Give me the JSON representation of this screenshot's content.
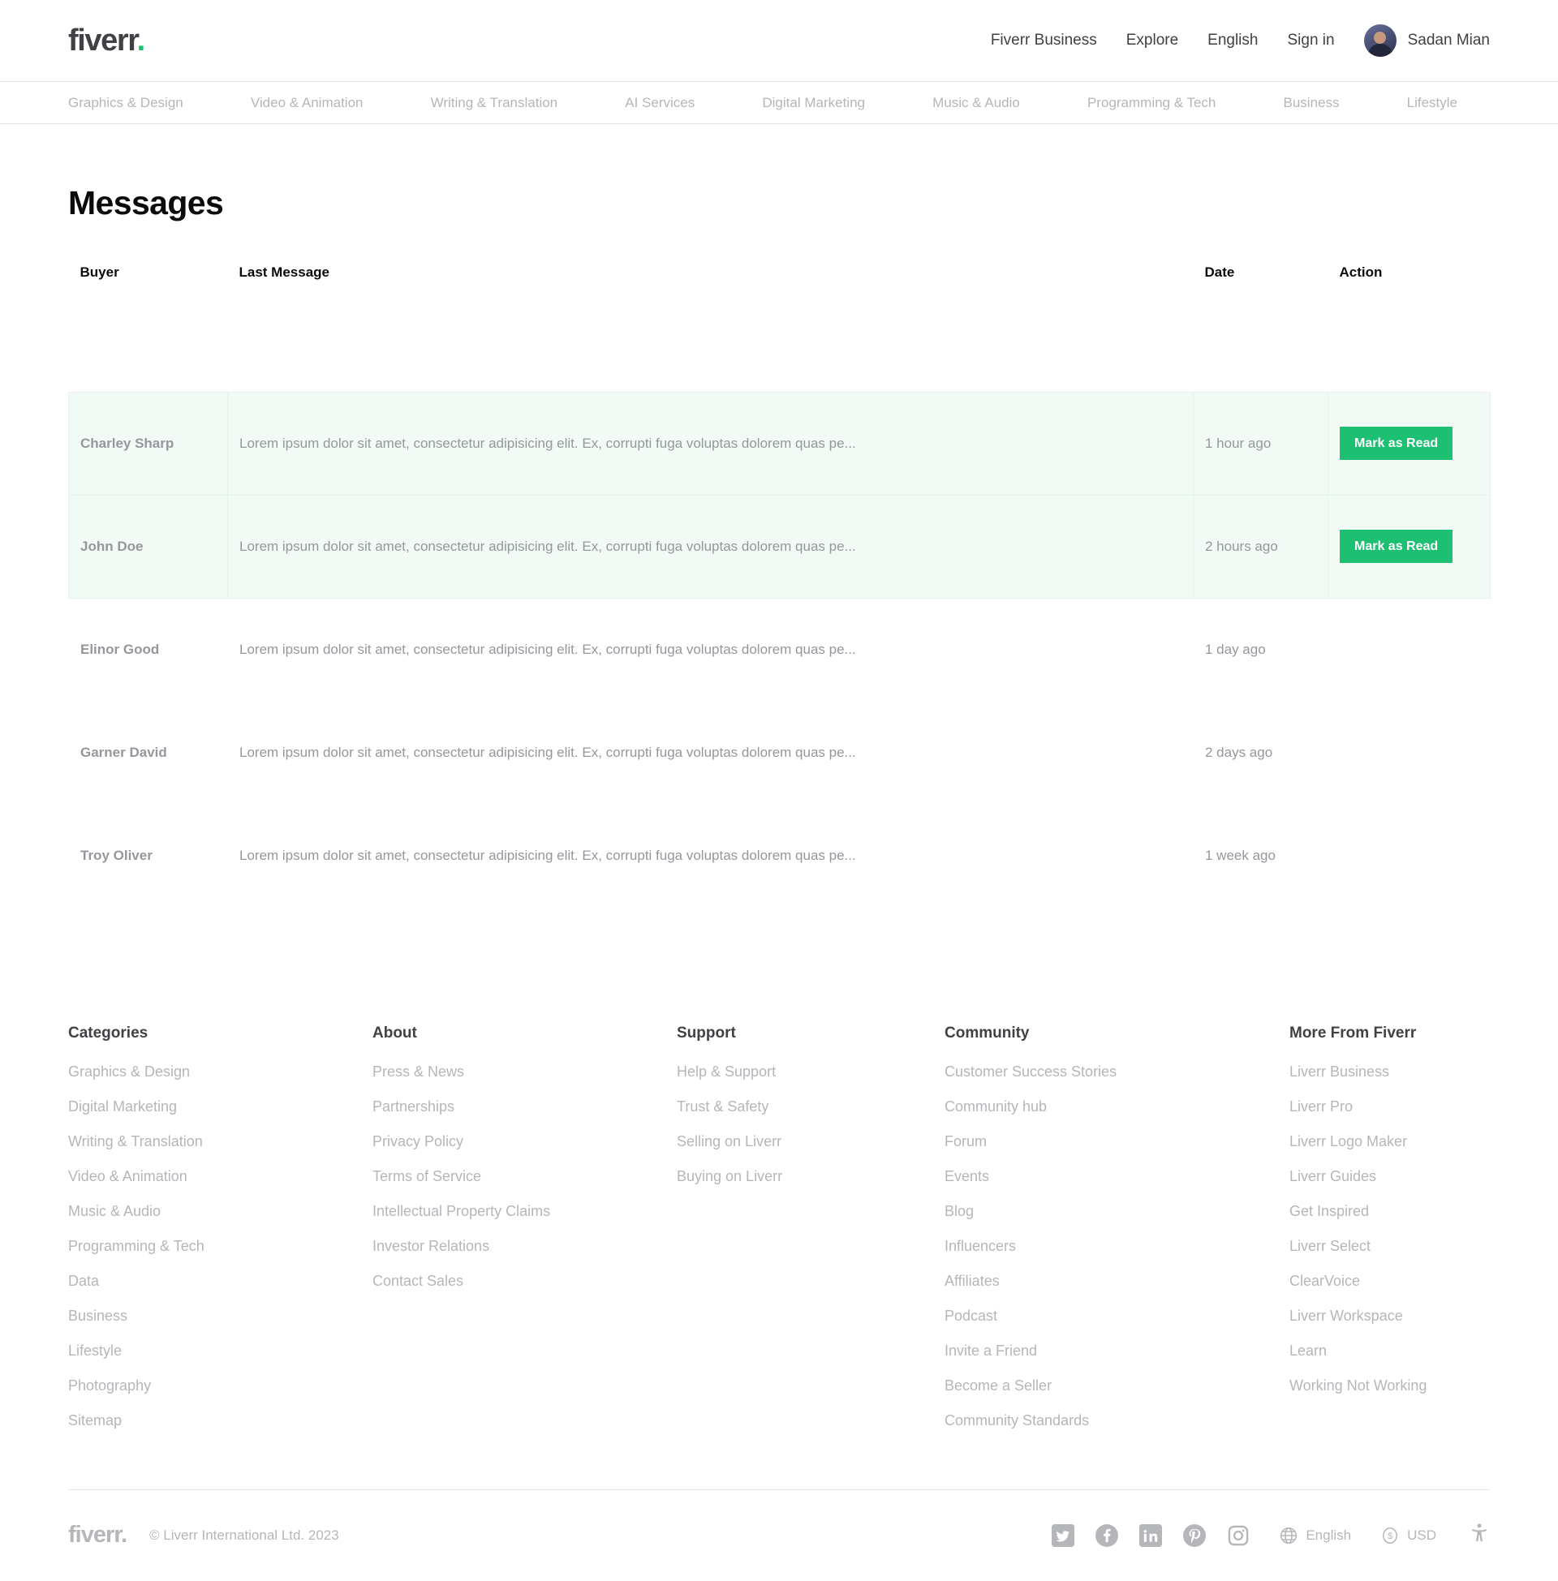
{
  "header": {
    "logo_text": "fiverr",
    "logo_dot": ".",
    "links": [
      {
        "label": "Fiverr Business",
        "name": "fiverr-business-link"
      },
      {
        "label": "Explore",
        "name": "explore-link"
      },
      {
        "label": "English",
        "name": "language-link"
      },
      {
        "label": "Sign in",
        "name": "sign-in-link"
      }
    ],
    "user_name": "Sadan Mian"
  },
  "category_nav": [
    "Graphics & Design",
    "Video & Animation",
    "Writing & Translation",
    "AI Services",
    "Digital Marketing",
    "Music & Audio",
    "Programming & Tech",
    "Business",
    "Lifestyle"
  ],
  "page": {
    "title": "Messages"
  },
  "table": {
    "columns": [
      "Buyer",
      "Last Message",
      "Date",
      "Action"
    ],
    "action_button_label": "Mark as Read",
    "rows": [
      {
        "buyer": "Charley Sharp",
        "message": "Lorem ipsum dolor sit amet, consectetur adipisicing elit. Ex, corrupti fuga voluptas dolorem quas pe...",
        "date": "1 hour ago",
        "unread": true,
        "action": "Mark as Read"
      },
      {
        "buyer": "John Doe",
        "message": "Lorem ipsum dolor sit amet, consectetur adipisicing elit. Ex, corrupti fuga voluptas dolorem quas pe...",
        "date": "2 hours ago",
        "unread": true,
        "action": "Mark as Read"
      },
      {
        "buyer": "Elinor Good",
        "message": "Lorem ipsum dolor sit amet, consectetur adipisicing elit. Ex, corrupti fuga voluptas dolorem quas pe...",
        "date": "1 day ago",
        "unread": false,
        "action": ""
      },
      {
        "buyer": "Garner David",
        "message": "Lorem ipsum dolor sit amet, consectetur adipisicing elit. Ex, corrupti fuga voluptas dolorem quas pe...",
        "date": "2 days ago",
        "unread": false,
        "action": ""
      },
      {
        "buyer": "Troy Oliver",
        "message": "Lorem ipsum dolor sit amet, consectetur adipisicing elit. Ex, corrupti fuga voluptas dolorem quas pe...",
        "date": "1 week ago",
        "unread": false,
        "action": ""
      }
    ]
  },
  "footer": {
    "columns": [
      {
        "heading": "Categories",
        "items": [
          "Graphics & Design",
          "Digital Marketing",
          "Writing & Translation",
          "Video & Animation",
          "Music & Audio",
          "Programming & Tech",
          "Data",
          "Business",
          "Lifestyle",
          "Photography",
          "Sitemap"
        ]
      },
      {
        "heading": "About",
        "items": [
          "Press & News",
          "Partnerships",
          "Privacy Policy",
          "Terms of Service",
          "Intellectual Property Claims",
          "Investor Relations",
          "Contact Sales"
        ]
      },
      {
        "heading": "Support",
        "items": [
          "Help & Support",
          "Trust & Safety",
          "Selling on Liverr",
          "Buying on Liverr"
        ]
      },
      {
        "heading": "Community",
        "items": [
          "Customer Success Stories",
          "Community hub",
          "Forum",
          "Events",
          "Blog",
          "Influencers",
          "Affiliates",
          "Podcast",
          "Invite a Friend",
          "Become a Seller",
          "Community Standards"
        ]
      },
      {
        "heading": "More From Fiverr",
        "items": [
          "Liverr Business",
          "Liverr Pro",
          "Liverr Logo Maker",
          "Liverr Guides",
          "Get Inspired",
          "Liverr Select",
          "ClearVoice",
          "Liverr Workspace",
          "Learn",
          "Working Not Working"
        ]
      }
    ],
    "bottom": {
      "logo_text": "fiverr",
      "logo_dot": ".",
      "copyright": "© Liverr International Ltd. 2023",
      "social": [
        "twitter-icon",
        "facebook-icon",
        "linkedin-icon",
        "pinterest-icon",
        "instagram-icon"
      ],
      "language": "English",
      "currency": "USD",
      "accessibility": "accessibility-icon"
    }
  },
  "colors": {
    "brand_green": "#1dbf73",
    "unread_row_bg": "#f1faf5",
    "unread_row_border": "#e3f2ea",
    "muted_text": "#b5b6ba",
    "body_text": "#404145",
    "heading_text": "#0b0b0b"
  }
}
